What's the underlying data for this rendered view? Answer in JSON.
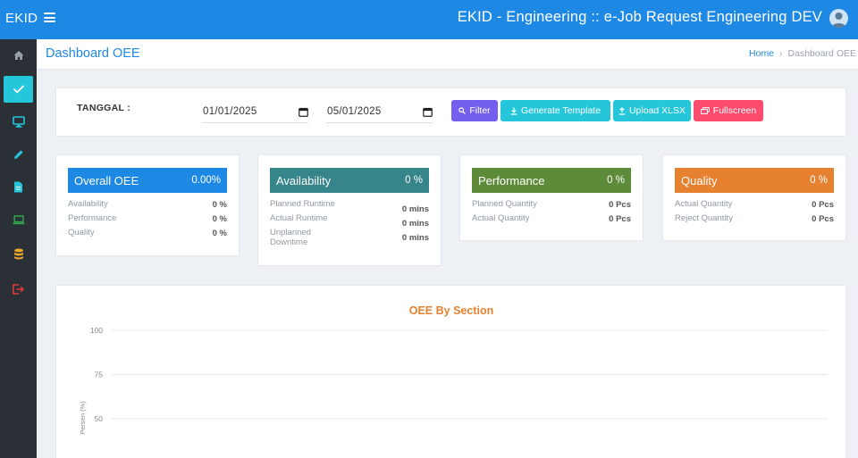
{
  "app": {
    "brand": "EKID",
    "title": "EKID - Engineering :: e-Job Request Engineering DEV"
  },
  "sidebar": {
    "items": [
      {
        "icon": "home-icon"
      },
      {
        "icon": "check-icon",
        "active": true
      },
      {
        "icon": "monitor-icon"
      },
      {
        "icon": "pencil-icon"
      },
      {
        "icon": "document-icon"
      },
      {
        "icon": "laptop-icon"
      },
      {
        "icon": "database-icon"
      },
      {
        "icon": "logout-icon"
      }
    ]
  },
  "header": {
    "page_title": "Dashboard OEE",
    "breadcrumb": {
      "home": "Home",
      "current": "Dashboard OEE"
    }
  },
  "filter": {
    "label": "TANGGAL :",
    "start_date": "01/01/2025",
    "end_date": "05/01/2025",
    "buttons": {
      "filter": "Filter",
      "generate_template": "Generate Template",
      "upload_xlsx": "Upload XLSX",
      "fullscreen": "Fullscreen"
    }
  },
  "cards": {
    "overall": {
      "title": "Overall OEE",
      "value": "0.00%",
      "rows": [
        {
          "label": "Availability",
          "value": "0 %"
        },
        {
          "label": "Performance",
          "value": "0 %"
        },
        {
          "label": "Quality",
          "value": "0 %"
        }
      ]
    },
    "availability": {
      "title": "Availability",
      "value": "0 %",
      "rows": [
        {
          "label": "Planned Runtime",
          "value": "0 mins"
        },
        {
          "label": "Actual Runtime",
          "value": "0 mins"
        },
        {
          "label": "Unplanned Downtime",
          "value": "0 mins"
        }
      ]
    },
    "performance": {
      "title": "Performance",
      "value": "0 %",
      "rows": [
        {
          "label": "Planned Quantity",
          "value": "0 Pcs"
        },
        {
          "label": "Actual Quantity",
          "value": "0 Pcs"
        }
      ]
    },
    "quality": {
      "title": "Quality",
      "value": "0 %",
      "rows": [
        {
          "label": "Actual Quantity",
          "value": "0 Pcs"
        },
        {
          "label": "Reject Quantity",
          "value": "0 Pcs"
        }
      ]
    }
  },
  "colors": {
    "primary": "#1e88e5",
    "overall": "#1e88e5",
    "availability": "#35858b",
    "performance": "#5e8b3a",
    "quality": "#e6812f",
    "btn_filter": "#7460ee",
    "btn_info": "#26c6da",
    "btn_fullscreen": "#fc4b6c",
    "chart_title": "#e6812f"
  },
  "chart_data": {
    "type": "bar",
    "title": "OEE By Section",
    "ylabel": "Persen (%)",
    "xlabel": "",
    "ylim": [
      0,
      100
    ],
    "yticks": [
      100,
      75,
      50
    ],
    "grid": true,
    "categories": [],
    "series": []
  }
}
